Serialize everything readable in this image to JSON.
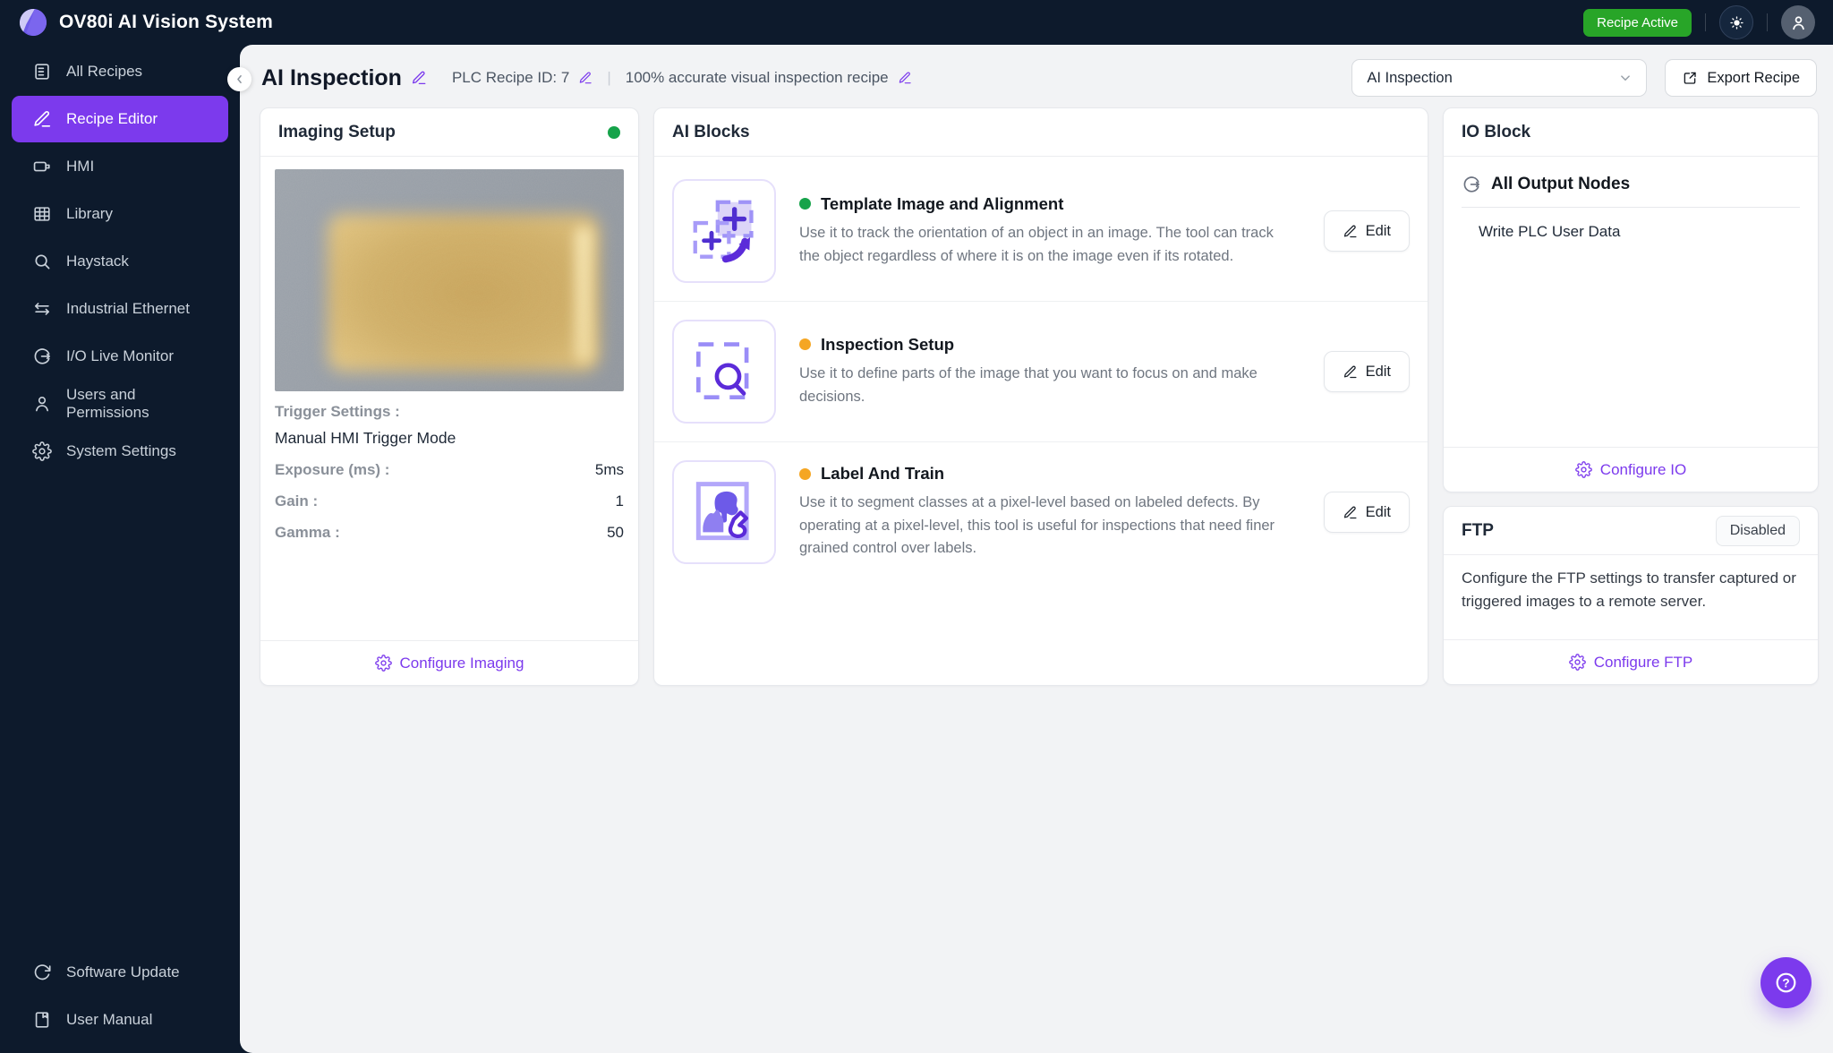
{
  "app": {
    "title": "OV80i AI Vision System",
    "badge": "Recipe Active"
  },
  "colors": {
    "accent": "#7c3aed",
    "green": "#16a34a",
    "orange": "#f5a623",
    "badge_green": "#28a528",
    "topbar": "#0d1a2c"
  },
  "sidebar": {
    "items": [
      {
        "id": "all-recipes",
        "label": "All Recipes",
        "icon": "recipes",
        "active": false
      },
      {
        "id": "recipe-editor",
        "label": "Recipe Editor",
        "icon": "pen",
        "active": true
      },
      {
        "id": "hmi",
        "label": "HMI",
        "icon": "hmi",
        "active": false
      },
      {
        "id": "library",
        "label": "Library",
        "icon": "grid",
        "active": false
      },
      {
        "id": "haystack",
        "label": "Haystack",
        "icon": "search",
        "active": false
      },
      {
        "id": "industrial-ethernet",
        "label": "Industrial Ethernet",
        "icon": "ethernet",
        "active": false
      },
      {
        "id": "io-live-monitor",
        "label": "I/O Live Monitor",
        "icon": "io",
        "active": false
      },
      {
        "id": "users-and-permissions",
        "label": "Users and Permissions",
        "icon": "user",
        "active": false
      },
      {
        "id": "system-settings",
        "label": "System Settings",
        "icon": "gear",
        "active": false
      }
    ],
    "bottom_items": [
      {
        "id": "software-update",
        "label": "Software Update",
        "icon": "refresh",
        "active": false
      },
      {
        "id": "user-manual",
        "label": "User Manual",
        "icon": "book",
        "active": false
      }
    ]
  },
  "header": {
    "title": "AI Inspection",
    "plc": "PLC Recipe ID: 7",
    "separator": "|",
    "subtitle": "100% accurate visual inspection recipe",
    "select_value": "AI Inspection",
    "export_label": "Export Recipe"
  },
  "imaging": {
    "title": "Imaging Setup",
    "status_color": "#16a34a",
    "trigger_label": "Trigger Settings :",
    "trigger_value": "Manual HMI Trigger Mode",
    "rows": [
      {
        "label": "Exposure (ms) :",
        "value": "5ms"
      },
      {
        "label": "Gain :",
        "value": "1"
      },
      {
        "label": "Gamma :",
        "value": "50"
      }
    ],
    "footer_link": "Configure Imaging"
  },
  "ai_blocks": {
    "title": "AI Blocks",
    "edit_label": "Edit",
    "blocks": [
      {
        "name": "Template Image and Alignment",
        "status_color": "#16a34a",
        "icon": "template-alignment",
        "description": "Use it to track the orientation of an object in an image. The tool can track the object regardless of where it is on the image even if its rotated."
      },
      {
        "name": "Inspection Setup",
        "status_color": "#f5a623",
        "icon": "inspection-setup",
        "description": "Use it to define parts of the image that you want to focus on and make decisions."
      },
      {
        "name": "Label And Train",
        "status_color": "#f5a623",
        "icon": "label-train",
        "description": "Use it to segment classes at a pixel-level based on labeled defects. By operating at a pixel-level, this tool is useful for inspections that need finer grained control over labels."
      }
    ]
  },
  "io_block": {
    "title": "IO Block",
    "group_title": "All Output Nodes",
    "node": "Write PLC User Data",
    "footer_link": "Configure IO"
  },
  "ftp": {
    "title": "FTP",
    "badge": "Disabled",
    "description": "Configure the FTP settings to transfer captured or triggered images to a remote server.",
    "footer_link": "Configure FTP"
  }
}
